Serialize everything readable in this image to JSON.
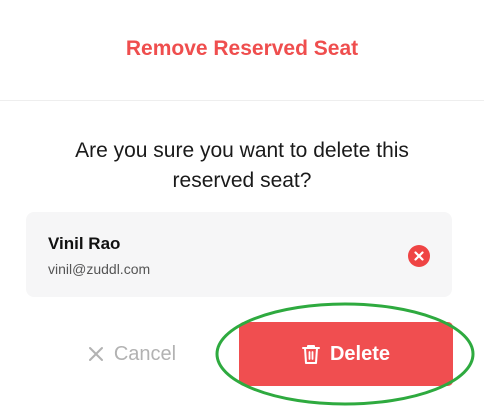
{
  "colors": {
    "accent": "#ef4e4e",
    "delete_bg": "#f04e50",
    "remove_icon_bg": "#ef4444",
    "highlight_ring": "#2eaa3f"
  },
  "dialog": {
    "title": "Remove Reserved Seat",
    "question_line1": "Are you sure you want to delete this",
    "question_line2": "reserved seat?"
  },
  "seat": {
    "name": "Vinil Rao",
    "email": "vinil@zuddl.com",
    "remove_icon": "close-circle-icon"
  },
  "actions": {
    "cancel_label": "Cancel",
    "cancel_icon": "close-icon",
    "delete_label": "Delete",
    "delete_icon": "trash-icon"
  }
}
